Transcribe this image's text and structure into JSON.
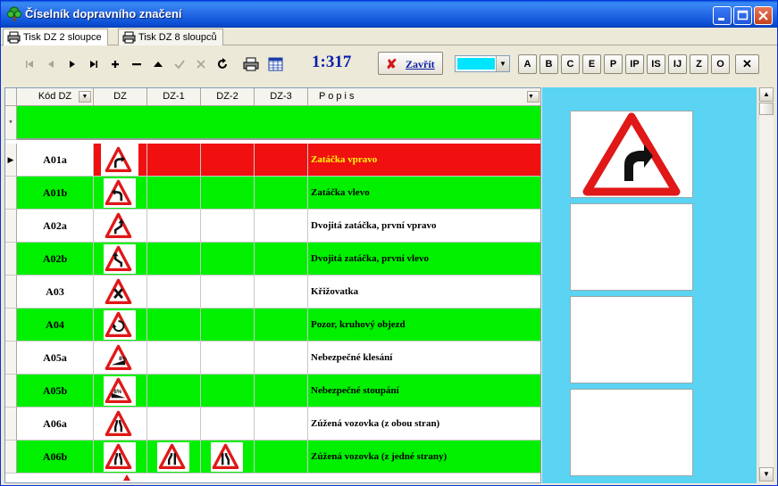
{
  "window": {
    "title": "Číselník dopravního značení"
  },
  "tabs": [
    {
      "label": "Tisk DZ 2 sloupce"
    },
    {
      "label": "Tisk DZ 8 sloupců"
    }
  ],
  "toolbar": {
    "record_counter": "1:317",
    "close_label": "Zavřít",
    "selected_color": "#00e5ff",
    "letter_buttons": [
      "A",
      "B",
      "C",
      "E",
      "P",
      "IP",
      "IS",
      "IJ",
      "Z",
      "O"
    ],
    "clear_label": "✕"
  },
  "grid": {
    "columns": [
      "Kód DZ",
      "DZ",
      "DZ-1",
      "DZ-2",
      "DZ-3",
      "P o p i s"
    ],
    "new_row_marker": "*",
    "current_row_marker": "▶",
    "rows": [
      {
        "code": "A01a",
        "description": "Zatáčka vpravo",
        "sign": "curve-right",
        "extra": [],
        "state": "selected"
      },
      {
        "code": "A01b",
        "description": "Zatáčka vlevo",
        "sign": "curve-left",
        "extra": [],
        "state": "green"
      },
      {
        "code": "A02a",
        "description": "Dvojitá zatáčka, první vpravo",
        "sign": "double-right",
        "extra": [],
        "state": "white"
      },
      {
        "code": "A02b",
        "description": "Dvojitá zatáčka, první vlevo",
        "sign": "double-left",
        "extra": [],
        "state": "green"
      },
      {
        "code": "A03",
        "description": "Křižovatka",
        "sign": "crossroad",
        "extra": [],
        "state": "white"
      },
      {
        "code": "A04",
        "description": "Pozor, kruhový objezd",
        "sign": "roundabout",
        "extra": [],
        "state": "green"
      },
      {
        "code": "A05a",
        "description": "Nebezpečné klesání",
        "sign": "descent",
        "extra": [],
        "state": "white"
      },
      {
        "code": "A05b",
        "description": "Nebezpečné stoupání",
        "sign": "ascent",
        "extra": [],
        "state": "green"
      },
      {
        "code": "A06a",
        "description": "Zúžená vozovka (z obou stran)",
        "sign": "narrow-both",
        "extra": [],
        "state": "white"
      },
      {
        "code": "A06b",
        "description": "Zúžená vozovka (z jedné strany)",
        "sign": "narrow-both",
        "extra": [
          "narrow-left",
          "narrow-right"
        ],
        "state": "green"
      }
    ]
  },
  "colors": {
    "green": "#00f000",
    "selected": "#f01010",
    "selected_text": "#ffff00",
    "preview_bg": "#5bd3f3"
  }
}
